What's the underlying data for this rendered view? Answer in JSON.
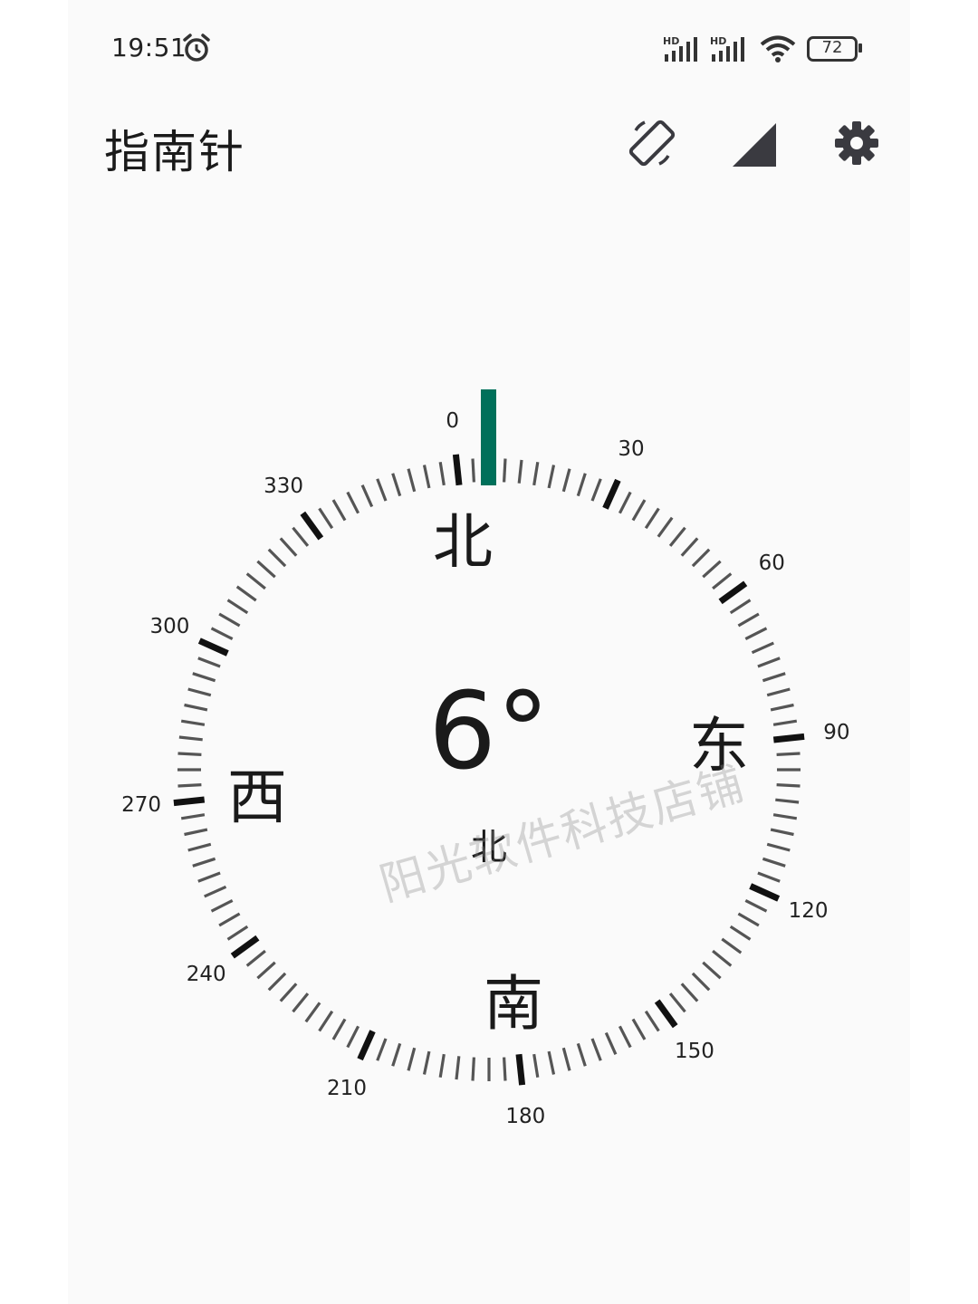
{
  "status_bar": {
    "time": "19:51",
    "battery": "72",
    "signal_label": "HD",
    "icons": [
      "alarm-icon",
      "hd-signal-icon",
      "hd-signal-icon",
      "wifi-icon",
      "battery-icon"
    ]
  },
  "header": {
    "title": "指南针",
    "actions": [
      "screen-rotate-icon",
      "signal-triangle-icon",
      "gear-icon"
    ]
  },
  "compass": {
    "heading_degrees": 6,
    "heading_text": "6°",
    "heading_direction": "北",
    "cardinals": {
      "north": "北",
      "east": "东",
      "south": "南",
      "west": "西"
    },
    "degree_labels": [
      "0",
      "30",
      "60",
      "90",
      "120",
      "150",
      "180",
      "210",
      "240",
      "270",
      "300",
      "330"
    ],
    "indicator_color": "#00705a"
  },
  "watermark": "阳光软件科技店铺"
}
